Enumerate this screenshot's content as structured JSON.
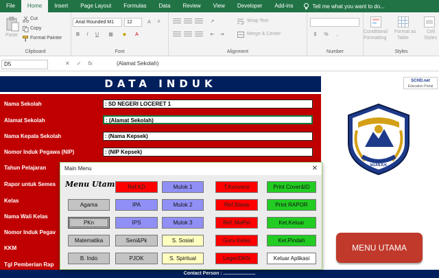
{
  "ribbon_tabs": [
    "File",
    "Home",
    "Insert",
    "Page Layout",
    "Formulas",
    "Data",
    "Review",
    "View",
    "Developer",
    "Add-ins"
  ],
  "tell_me": "Tell me what you want to do...",
  "clipboard": {
    "paste": "Paste",
    "cut": "Cut",
    "copy": "Copy",
    "format_painter": "Format Painter",
    "group": "Clipboard"
  },
  "font": {
    "name": "Arial Rounded M1",
    "size": "12",
    "group": "Font"
  },
  "alignment": {
    "wrap": "Wrap Text",
    "merge": "Merge & Center",
    "group": "Alignment"
  },
  "number": {
    "group": "Number"
  },
  "styles": {
    "conditional": "Conditional",
    "formatting": "Formatting",
    "format_as": "Format as",
    "table": "Table",
    "cell": "Cell",
    "styles_label": "Styles",
    "group": "Styles"
  },
  "formula_bar": {
    "cell": "D5",
    "fx": "fx",
    "content": "(Alamat Sekolah)"
  },
  "sheet": {
    "title": "DATA INDUK",
    "logo_text": "SCHD.net",
    "logo_sub": "Education Portal",
    "labels": [
      "Nama Sekolah",
      "Alamat Sekolah",
      "Nama Kepala Sekolah",
      "Nomor Induk Pegawa (NIP)",
      "Tahun Pelajaran",
      "Rapor untuk Semes",
      "Kelas",
      "Nama Wali Kelas",
      "Nomor Induk Pegav",
      "KKM",
      "Tgl Pemberian Rap"
    ],
    "values": [
      ": SD NEGERI LOCERET 1",
      ": (Alamat Sekolah)",
      ": (Nama Kepsek)",
      ": (NIP Kepsek)"
    ],
    "menu_utama_button": "MENU UTAMA",
    "emblem_text": "NGANJUK",
    "emblem_motto": "GAWANGA YUWANA",
    "footer": "Contact Person : ........................"
  },
  "dialog": {
    "title": "Main Menu",
    "heading": "Menu Utama",
    "col1": [
      "Agama",
      "PKn",
      "Matematika",
      "B. Indo"
    ],
    "col2": [
      "IPA",
      "IPS",
      "Seni&Pk",
      "PJOK"
    ],
    "col_red1": [
      "Ref.KD"
    ],
    "col3": [
      "Mulok 1",
      "Mulok 2",
      "Mulok 3",
      "S. Sosial",
      "S. Spiritual"
    ],
    "col4": [
      "T.Konversi",
      "Ref.Siswa",
      "Ref. MaPel",
      "Guru Kelas",
      "Leger/DKN"
    ],
    "col5": [
      "Print Cover&ID",
      "Print RAPOR",
      "Ket.Keluar",
      "Ket.Pindah",
      "Keluar Aplikasi"
    ]
  }
}
